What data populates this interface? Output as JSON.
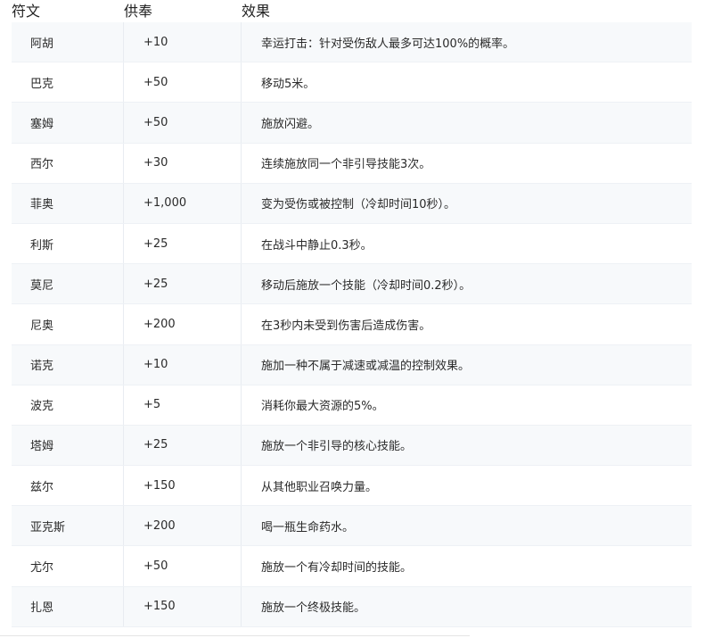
{
  "table": {
    "headers": {
      "rune": "符文",
      "devotion": "供奉",
      "effect": "效果"
    },
    "rows": [
      {
        "rune": "阿胡",
        "devotion": "+10",
        "effect": "幸运打击：针对受伤敌人最多可达100%的概率。"
      },
      {
        "rune": "巴克",
        "devotion": "+50",
        "effect": "移动5米。"
      },
      {
        "rune": "塞姆",
        "devotion": "+50",
        "effect": "施放闪避。"
      },
      {
        "rune": "西尔",
        "devotion": "+30",
        "effect": "连续施放同一个非引导技能3次。"
      },
      {
        "rune": "菲奥",
        "devotion": "+1,000",
        "effect": "变为受伤或被控制（冷却时间10秒）。"
      },
      {
        "rune": "利斯",
        "devotion": "+25",
        "effect": "在战斗中静止0.3秒。"
      },
      {
        "rune": "莫尼",
        "devotion": "+25",
        "effect": "移动后施放一个技能（冷却时间0.2秒）。"
      },
      {
        "rune": "尼奥",
        "devotion": "+200",
        "effect": "在3秒内未受到伤害后造成伤害。"
      },
      {
        "rune": "诺克",
        "devotion": "+10",
        "effect": "施加一种不属于减速或减温的控制效果。"
      },
      {
        "rune": "波克",
        "devotion": "+5",
        "effect": "消耗你最大资源的5%。"
      },
      {
        "rune": "塔姆",
        "devotion": "+25",
        "effect": "施放一个非引导的核心技能。"
      },
      {
        "rune": "兹尔",
        "devotion": "+150",
        "effect": "从其他职业召唤力量。"
      },
      {
        "rune": "亚克斯",
        "devotion": "+200",
        "effect": "喝一瓶生命药水。"
      },
      {
        "rune": "尤尔",
        "devotion": "+50",
        "effect": "施放一个有冷却时间的技能。"
      },
      {
        "rune": "扎恩",
        "devotion": "+150",
        "effect": "施放一个终极技能。"
      }
    ]
  }
}
